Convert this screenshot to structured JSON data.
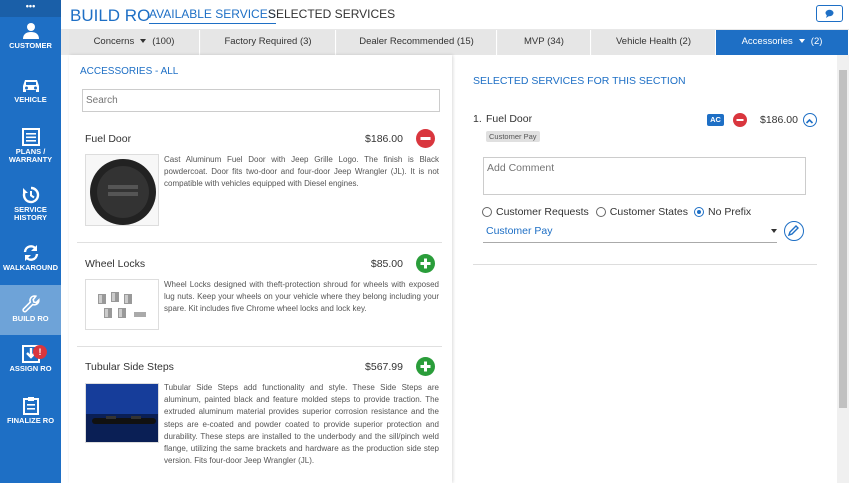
{
  "header": {
    "title": "BUILD RO",
    "tabs": [
      "AVAILABLE SERVICES",
      "SELECTED SERVICES"
    ]
  },
  "sidebar": {
    "top_label": "•••",
    "items": [
      {
        "label": "CUSTOMER",
        "icon": "person-icon"
      },
      {
        "label": "VEHICLE",
        "icon": "car-icon"
      },
      {
        "label": "PLANS / WARRANTY",
        "icon": "list-icon"
      },
      {
        "label": "SERVICE HISTORY",
        "icon": "history-icon"
      },
      {
        "label": "WALKAROUND",
        "icon": "refresh-icon"
      },
      {
        "label": "BUILD RO",
        "icon": "wrench-icon",
        "active": true
      },
      {
        "label": "ASSIGN RO",
        "icon": "download-icon",
        "badge": "!"
      },
      {
        "label": "FINALIZE RO",
        "icon": "clipboard-icon"
      }
    ]
  },
  "tabs": [
    {
      "label": "Concerns",
      "count": "(100)"
    },
    {
      "label": "Factory Required (3)"
    },
    {
      "label": "Dealer Recommended (15)"
    },
    {
      "label": "MVP (34)"
    },
    {
      "label": "Vehicle Health (2)"
    },
    {
      "label": "Accessories",
      "count": "(2)",
      "active": true
    }
  ],
  "accessories": {
    "title": "ACCESSORIES - ALL",
    "search_placeholder": "Search",
    "items": [
      {
        "name": "Fuel Door",
        "price": "$186.00",
        "action": "remove",
        "description": "Cast Aluminum Fuel Door with Jeep Grille Logo. The finish is Black powdercoat. Door fits two-door and four-door Jeep Wrangler (JL). It is not compatible with vehicles equipped with Diesel engines."
      },
      {
        "name": "Wheel Locks",
        "price": "$85.00",
        "action": "add",
        "description": "Wheel Locks designed with theft-protection shroud for wheels with exposed lug nuts. Keep your wheels on your vehicle where they belong including your spare. Kit includes five Chrome wheel locks and lock key."
      },
      {
        "name": "Tubular Side Steps",
        "price": "$567.99",
        "action": "add",
        "description": "Tubular Side Steps add functionality and style. These Side Steps are aluminum, painted black and feature molded steps to provide traction. The extruded aluminum material provides superior corrosion resistance and the steps are e-coated and powder coated to provide superior protection and durability. These steps are installed to the underbody and the sill/pinch weld flange, utilizing the same brackets and hardware as the production side step version. Fits four-door Jeep Wrangler (JL)."
      }
    ]
  },
  "selected": {
    "title": "SELECTED SERVICES FOR THIS SECTION",
    "items": [
      {
        "index": "1.",
        "name": "Fuel Door",
        "tag": "Customer Pay",
        "badge": "AC",
        "price": "$186.00",
        "comment_placeholder": "Add Comment",
        "radio_options": [
          "Customer Requests",
          "Customer States",
          "No Prefix"
        ],
        "radio_selected": "No Prefix",
        "pay_type": "Customer Pay"
      }
    ]
  },
  "colors": {
    "brand": "#1e6fc5",
    "remove": "#d9363e",
    "add": "#2a9d3a"
  }
}
